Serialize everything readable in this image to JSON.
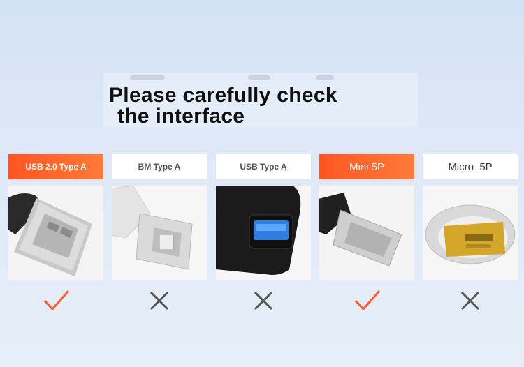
{
  "headline": {
    "line1": "Please carefully check",
    "line2": "the interface"
  },
  "cards": [
    {
      "label": "USB 2.0 Type A",
      "compatible": true,
      "status_icon": "check-icon"
    },
    {
      "label": "BM Type A",
      "compatible": false,
      "status_icon": "cross-icon"
    },
    {
      "label": "USB Type A",
      "compatible": false,
      "status_icon": "cross-icon"
    },
    {
      "label": "Mini 5P",
      "compatible": true,
      "status_icon": "check-icon"
    },
    {
      "label": "Micro  5P",
      "compatible": false,
      "status_icon": "cross-icon"
    }
  ],
  "colors": {
    "accent": "#ff5a26",
    "check": "#ff5a26",
    "cross": "#555555"
  }
}
